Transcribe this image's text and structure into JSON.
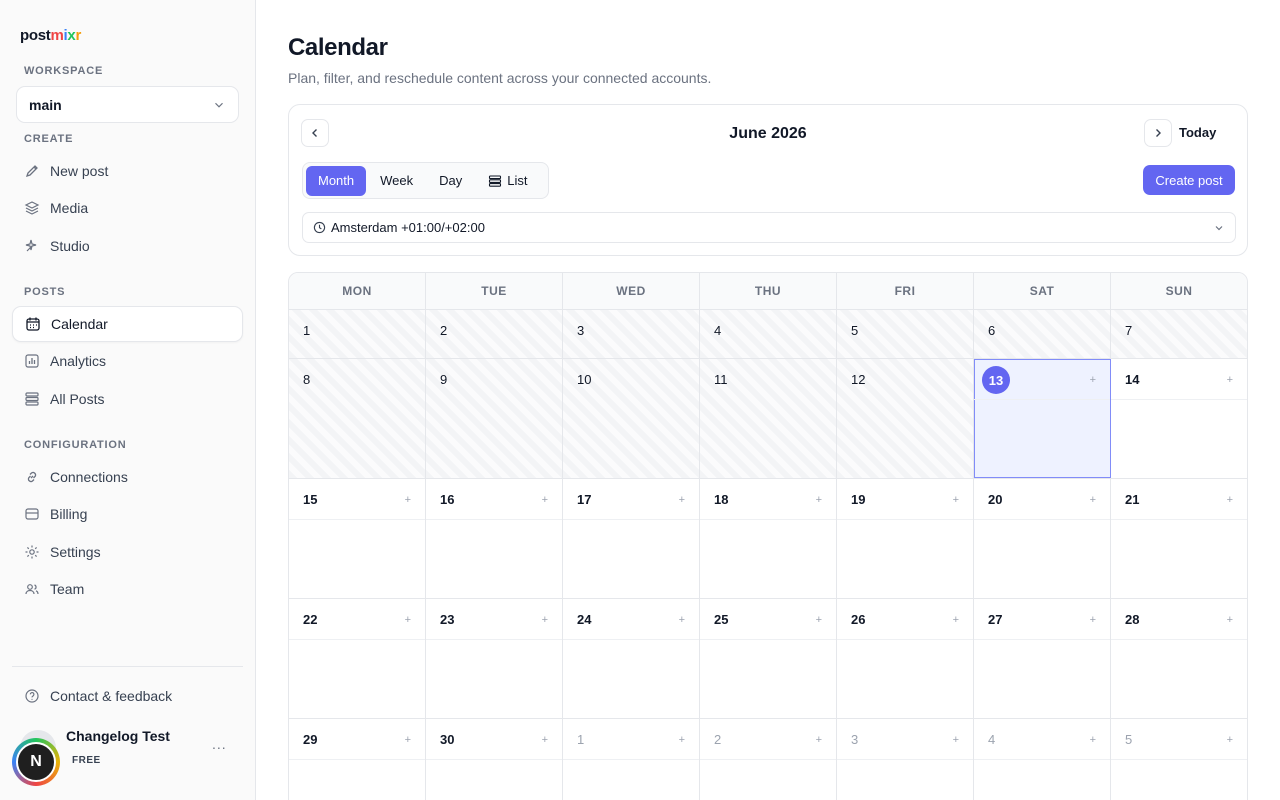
{
  "app": {
    "logo_parts": [
      "post",
      "m",
      "i",
      "x",
      "r"
    ]
  },
  "sidebar": {
    "workspace_label": "WORKSPACE",
    "workspace_value": "main",
    "create_label": "CREATE",
    "create_items": [
      {
        "label": "New post",
        "icon": "edit-icon"
      },
      {
        "label": "Media",
        "icon": "layers-icon"
      },
      {
        "label": "Studio",
        "icon": "sparkles-icon"
      }
    ],
    "posts_label": "POSTS",
    "posts_items": [
      {
        "label": "Calendar",
        "icon": "calendar-icon",
        "active": true
      },
      {
        "label": "Analytics",
        "icon": "chart-icon"
      },
      {
        "label": "All Posts",
        "icon": "list-icon"
      }
    ],
    "config_label": "CONFIGURATION",
    "config_items": [
      {
        "label": "Connections",
        "icon": "link-icon"
      },
      {
        "label": "Billing",
        "icon": "credit-card-icon"
      },
      {
        "label": "Settings",
        "icon": "gear-icon"
      },
      {
        "label": "Team",
        "icon": "users-icon"
      }
    ],
    "contact_label": "Contact & feedback",
    "user": {
      "name": "Changelog Test",
      "plan": "FREE",
      "initial": "N",
      "more": "..."
    }
  },
  "main": {
    "title": "Calendar",
    "subtitle": "Plan, filter, and reschedule content across your connected accounts.",
    "month": "June 2026",
    "today_label": "Today",
    "views": [
      "Month",
      "Week",
      "Day",
      "List"
    ],
    "active_view": "Month",
    "create_label": "Create post",
    "timezone": "Amsterdam +01:00/+02:00"
  },
  "calendar": {
    "weekdays": [
      "MON",
      "TUE",
      "WED",
      "THU",
      "FRI",
      "SAT",
      "SUN"
    ],
    "add_symbol": "+",
    "weeks": [
      [
        {
          "d": "1",
          "t": "past"
        },
        {
          "d": "2",
          "t": "past"
        },
        {
          "d": "3",
          "t": "past"
        },
        {
          "d": "4",
          "t": "past"
        },
        {
          "d": "5",
          "t": "past"
        },
        {
          "d": "6",
          "t": "past"
        },
        {
          "d": "7",
          "t": "past"
        }
      ],
      [
        {
          "d": "8",
          "t": "past"
        },
        {
          "d": "9",
          "t": "past"
        },
        {
          "d": "10",
          "t": "past"
        },
        {
          "d": "11",
          "t": "past"
        },
        {
          "d": "12",
          "t": "past"
        },
        {
          "d": "13",
          "t": "today"
        },
        {
          "d": "14",
          "t": "cur"
        }
      ],
      [
        {
          "d": "15",
          "t": "cur"
        },
        {
          "d": "16",
          "t": "cur"
        },
        {
          "d": "17",
          "t": "cur"
        },
        {
          "d": "18",
          "t": "cur"
        },
        {
          "d": "19",
          "t": "cur"
        },
        {
          "d": "20",
          "t": "cur"
        },
        {
          "d": "21",
          "t": "cur"
        }
      ],
      [
        {
          "d": "22",
          "t": "cur"
        },
        {
          "d": "23",
          "t": "cur"
        },
        {
          "d": "24",
          "t": "cur"
        },
        {
          "d": "25",
          "t": "cur"
        },
        {
          "d": "26",
          "t": "cur"
        },
        {
          "d": "27",
          "t": "cur"
        },
        {
          "d": "28",
          "t": "cur"
        }
      ],
      [
        {
          "d": "29",
          "t": "cur"
        },
        {
          "d": "30",
          "t": "cur"
        },
        {
          "d": "1",
          "t": "other"
        },
        {
          "d": "2",
          "t": "other"
        },
        {
          "d": "3",
          "t": "other"
        },
        {
          "d": "4",
          "t": "other"
        },
        {
          "d": "5",
          "t": "other"
        }
      ]
    ]
  }
}
